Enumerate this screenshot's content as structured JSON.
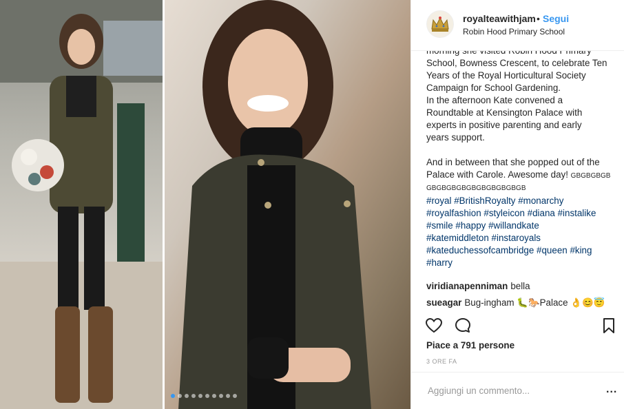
{
  "header": {
    "username": "royalteawithjam",
    "separator": "•",
    "follow_label": "Segui",
    "location": "Robin Hood Primary School",
    "avatar_icon": "crown-icon"
  },
  "media": {
    "carousel_dots": 10,
    "active_dot": 0,
    "accent_color": "#3897f0"
  },
  "caption": {
    "lines": [
      "morning she visited Robin Hood Primary",
      "School, Bowness Crescent, to celebrate Ten",
      "Years of the Royal Horticultural Society",
      "Campaign for School Gardening.",
      "In the afternoon Kate convened a",
      "Roundtable at Kensington Palace with",
      "experts in positive parenting and early",
      "years support."
    ],
    "line_after_blank": "And in between that she popped out of the",
    "palace_line": "Palace with Carole. Awesome day!",
    "flags_inline": "GBGBGBGB",
    "flags_line": "GBGBGBGBGBGBGBGBGBGB",
    "hashtags": [
      "#royal #BritishRoyalty #monarchy",
      "#royalfashion #styleicon #diana #instalike",
      "#smile #happy #willandkate",
      "#katemiddleton #instaroyals",
      "#kateduchessofcambridge #queen #king",
      "#harry"
    ]
  },
  "comments": [
    {
      "user": "viridianapenniman",
      "text": "bella"
    },
    {
      "user": "sueagar",
      "text": "Bug-ingham 🐛🐎Palace 👌😊😇"
    }
  ],
  "actions": {
    "like_icon": "heart-icon",
    "comment_icon": "comment-icon",
    "save_icon": "bookmark-icon"
  },
  "likes_text": "Piace a 791 persone",
  "timestamp": "3 ORE FA",
  "add_comment": {
    "placeholder": "Aggiungi un commento...",
    "more_label": "..."
  }
}
